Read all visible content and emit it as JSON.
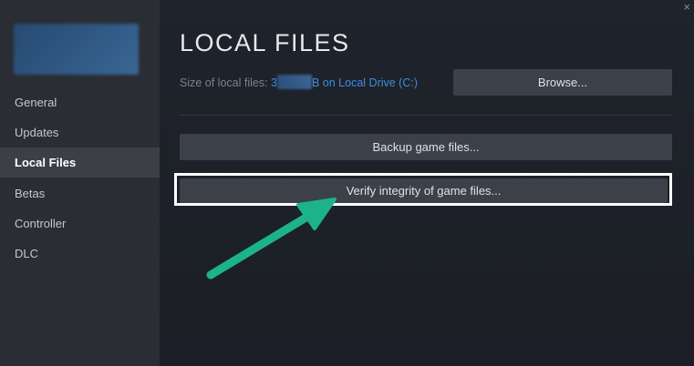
{
  "sidebar": {
    "items": [
      {
        "label": "General",
        "active": false
      },
      {
        "label": "Updates",
        "active": false
      },
      {
        "label": "Local Files",
        "active": true
      },
      {
        "label": "Betas",
        "active": false
      },
      {
        "label": "Controller",
        "active": false
      },
      {
        "label": "DLC",
        "active": false
      }
    ]
  },
  "main": {
    "title": "LOCAL FILES",
    "size_prefix": "Size of local files: ",
    "size_value_start": "3",
    "size_value_end": "B on Local Drive (C:)",
    "browse_label": "Browse...",
    "backup_label": "Backup game files...",
    "verify_label": "Verify integrity of game files...",
    "close_glyph": "×"
  },
  "colors": {
    "accent_link": "#3d8ee0",
    "arrow": "#1db38a",
    "highlight_border": "#ffffff"
  }
}
